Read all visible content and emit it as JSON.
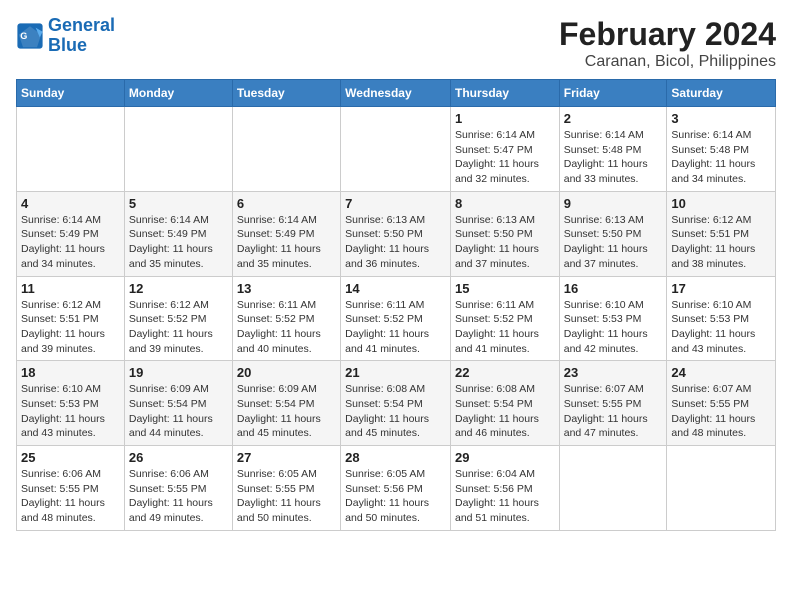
{
  "header": {
    "logo_line1": "General",
    "logo_line2": "Blue",
    "title": "February 2024",
    "subtitle": "Caranan, Bicol, Philippines"
  },
  "days_of_week": [
    "Sunday",
    "Monday",
    "Tuesday",
    "Wednesday",
    "Thursday",
    "Friday",
    "Saturday"
  ],
  "weeks": [
    [
      {
        "day": "",
        "info": ""
      },
      {
        "day": "",
        "info": ""
      },
      {
        "day": "",
        "info": ""
      },
      {
        "day": "",
        "info": ""
      },
      {
        "day": "1",
        "info": "Sunrise: 6:14 AM\nSunset: 5:47 PM\nDaylight: 11 hours and 32 minutes."
      },
      {
        "day": "2",
        "info": "Sunrise: 6:14 AM\nSunset: 5:48 PM\nDaylight: 11 hours and 33 minutes."
      },
      {
        "day": "3",
        "info": "Sunrise: 6:14 AM\nSunset: 5:48 PM\nDaylight: 11 hours and 34 minutes."
      }
    ],
    [
      {
        "day": "4",
        "info": "Sunrise: 6:14 AM\nSunset: 5:49 PM\nDaylight: 11 hours and 34 minutes."
      },
      {
        "day": "5",
        "info": "Sunrise: 6:14 AM\nSunset: 5:49 PM\nDaylight: 11 hours and 35 minutes."
      },
      {
        "day": "6",
        "info": "Sunrise: 6:14 AM\nSunset: 5:49 PM\nDaylight: 11 hours and 35 minutes."
      },
      {
        "day": "7",
        "info": "Sunrise: 6:13 AM\nSunset: 5:50 PM\nDaylight: 11 hours and 36 minutes."
      },
      {
        "day": "8",
        "info": "Sunrise: 6:13 AM\nSunset: 5:50 PM\nDaylight: 11 hours and 37 minutes."
      },
      {
        "day": "9",
        "info": "Sunrise: 6:13 AM\nSunset: 5:50 PM\nDaylight: 11 hours and 37 minutes."
      },
      {
        "day": "10",
        "info": "Sunrise: 6:12 AM\nSunset: 5:51 PM\nDaylight: 11 hours and 38 minutes."
      }
    ],
    [
      {
        "day": "11",
        "info": "Sunrise: 6:12 AM\nSunset: 5:51 PM\nDaylight: 11 hours and 39 minutes."
      },
      {
        "day": "12",
        "info": "Sunrise: 6:12 AM\nSunset: 5:52 PM\nDaylight: 11 hours and 39 minutes."
      },
      {
        "day": "13",
        "info": "Sunrise: 6:11 AM\nSunset: 5:52 PM\nDaylight: 11 hours and 40 minutes."
      },
      {
        "day": "14",
        "info": "Sunrise: 6:11 AM\nSunset: 5:52 PM\nDaylight: 11 hours and 41 minutes."
      },
      {
        "day": "15",
        "info": "Sunrise: 6:11 AM\nSunset: 5:52 PM\nDaylight: 11 hours and 41 minutes."
      },
      {
        "day": "16",
        "info": "Sunrise: 6:10 AM\nSunset: 5:53 PM\nDaylight: 11 hours and 42 minutes."
      },
      {
        "day": "17",
        "info": "Sunrise: 6:10 AM\nSunset: 5:53 PM\nDaylight: 11 hours and 43 minutes."
      }
    ],
    [
      {
        "day": "18",
        "info": "Sunrise: 6:10 AM\nSunset: 5:53 PM\nDaylight: 11 hours and 43 minutes."
      },
      {
        "day": "19",
        "info": "Sunrise: 6:09 AM\nSunset: 5:54 PM\nDaylight: 11 hours and 44 minutes."
      },
      {
        "day": "20",
        "info": "Sunrise: 6:09 AM\nSunset: 5:54 PM\nDaylight: 11 hours and 45 minutes."
      },
      {
        "day": "21",
        "info": "Sunrise: 6:08 AM\nSunset: 5:54 PM\nDaylight: 11 hours and 45 minutes."
      },
      {
        "day": "22",
        "info": "Sunrise: 6:08 AM\nSunset: 5:54 PM\nDaylight: 11 hours and 46 minutes."
      },
      {
        "day": "23",
        "info": "Sunrise: 6:07 AM\nSunset: 5:55 PM\nDaylight: 11 hours and 47 minutes."
      },
      {
        "day": "24",
        "info": "Sunrise: 6:07 AM\nSunset: 5:55 PM\nDaylight: 11 hours and 48 minutes."
      }
    ],
    [
      {
        "day": "25",
        "info": "Sunrise: 6:06 AM\nSunset: 5:55 PM\nDaylight: 11 hours and 48 minutes."
      },
      {
        "day": "26",
        "info": "Sunrise: 6:06 AM\nSunset: 5:55 PM\nDaylight: 11 hours and 49 minutes."
      },
      {
        "day": "27",
        "info": "Sunrise: 6:05 AM\nSunset: 5:55 PM\nDaylight: 11 hours and 50 minutes."
      },
      {
        "day": "28",
        "info": "Sunrise: 6:05 AM\nSunset: 5:56 PM\nDaylight: 11 hours and 50 minutes."
      },
      {
        "day": "29",
        "info": "Sunrise: 6:04 AM\nSunset: 5:56 PM\nDaylight: 11 hours and 51 minutes."
      },
      {
        "day": "",
        "info": ""
      },
      {
        "day": "",
        "info": ""
      }
    ]
  ]
}
